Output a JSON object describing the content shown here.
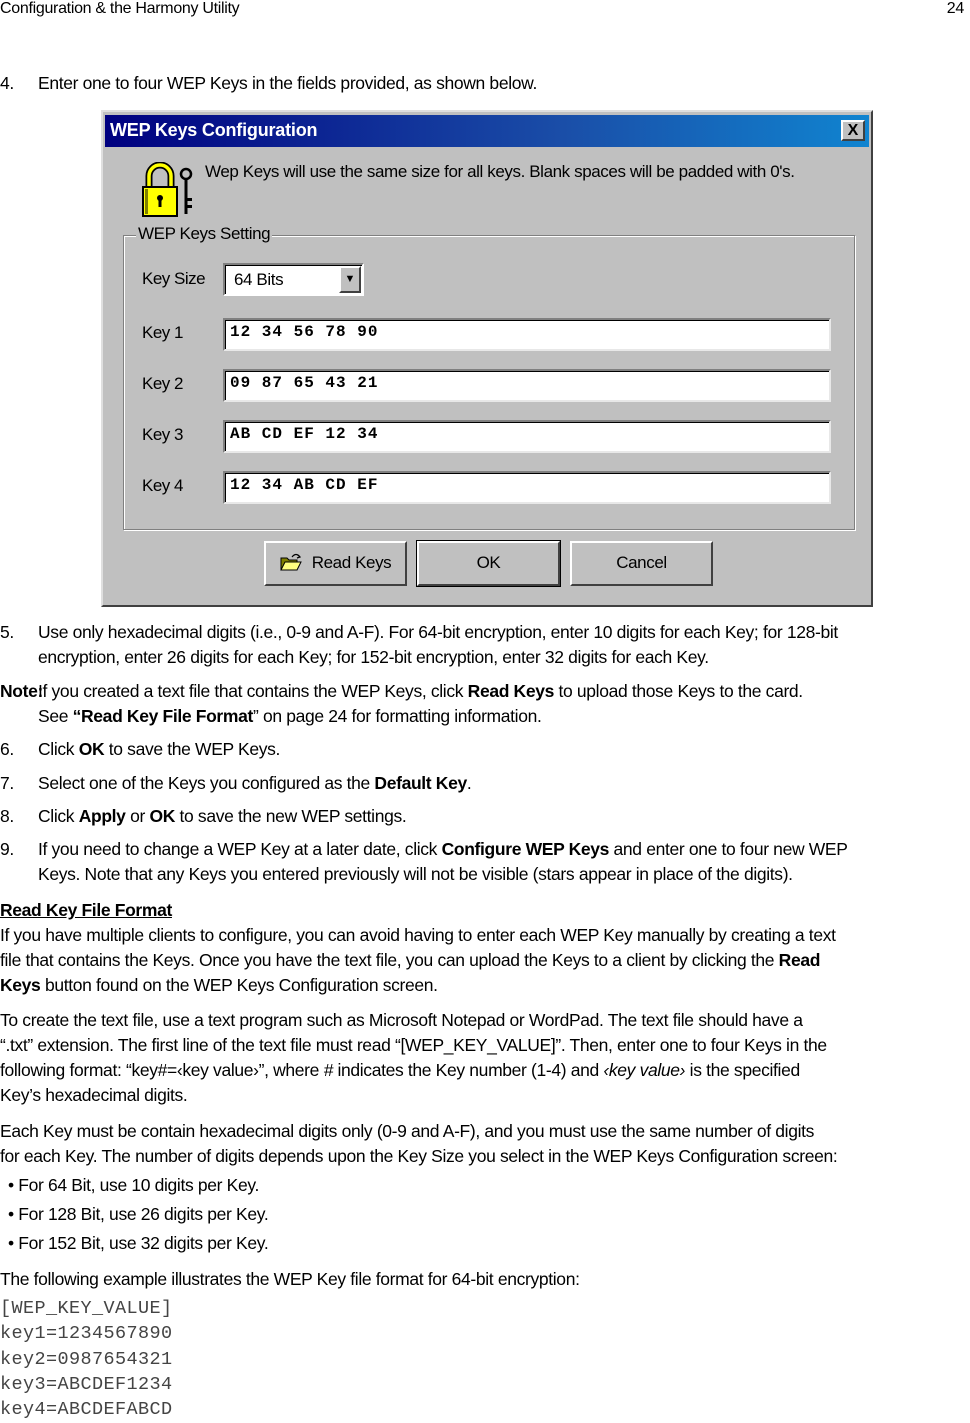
{
  "header": {
    "section_title": "Configuration & the Harmony Utility",
    "page_number": "24"
  },
  "step4": {
    "number": "4.",
    "text": "Enter one to four WEP Keys in the fields provided, as shown below."
  },
  "dialog": {
    "title": "WEP Keys Configuration",
    "close_label": "X",
    "info_text": "Wep Keys will use the same size for all keys. Blank spaces will be padded with 0's.",
    "group_label": "WEP Keys Setting",
    "key_size_label": "Key Size",
    "key_size_value": "64 Bits",
    "dropdown_arrow": "▼",
    "keys": [
      {
        "label": "Key 1",
        "value": "12 34 56 78 90"
      },
      {
        "label": "Key 2",
        "value": "09 87 65 43 21"
      },
      {
        "label": "Key 3",
        "value": "AB CD EF 12 34"
      },
      {
        "label": "Key 4",
        "value": "12 34 AB CD EF"
      }
    ],
    "buttons": {
      "read_keys": "Read Keys",
      "ok": "OK",
      "cancel": "Cancel"
    }
  },
  "step5": {
    "number": "5.",
    "line1": "Use only hexadecimal digits (i.e., 0-9 and A-F). For 64-bit encryption, enter 10 digits for each Key; for 128-bit",
    "line2": "encryption, enter 26 digits for each Key; for 152-bit encryption, enter 32 digits for each Key."
  },
  "note": {
    "label": "Note:",
    "l1_a": "If you created a text file that contains the WEP Keys, click ",
    "l1_b": "Read Keys",
    "l1_c": " to upload those Keys to the card.",
    "l2_a": "See ",
    "l2_b": "“Read Key File Format",
    "l2_c": "” on page 24 for formatting information."
  },
  "step6": {
    "number": "6.",
    "a": "Click ",
    "b": "OK",
    "c": " to save the WEP Keys."
  },
  "step7": {
    "number": "7.",
    "a": "Select one of the Keys you configured as the ",
    "b": "Default Key",
    "c": "."
  },
  "step8": {
    "number": "8.",
    "a": "Click ",
    "b": "Apply",
    "c": " or ",
    "d": "OK",
    "e": " to save the new WEP settings."
  },
  "step9": {
    "number": "9.",
    "a": "If you need to change a WEP Key at a later date, click ",
    "b": "Configure WEP Keys",
    "c": " and enter one to four new WEP",
    "line2": "Keys. Note that any Keys you entered previously will not be visible (stars appear in place of the digits)."
  },
  "read_key_section": {
    "heading": "Read Key File Format",
    "p1_l1": "If you have multiple clients to configure, you can avoid having to enter each WEP Key manually by creating a text",
    "p1_l2_a": "file that contains the Keys. Once you have the text file, you can upload the Keys to a client by clicking the ",
    "p1_l2_b": "Read",
    "p1_l3_a": "Keys",
    "p1_l3_b": " button found on the WEP Keys Configuration screen.",
    "p2_l1": "To create the text file, use a text program such as Microsoft Notepad or WordPad. The text file should have a",
    "p2_l2": "“.txt” extension. The first line of the text file must read “[WEP_KEY_VALUE]”. Then, enter one to four Keys in the",
    "p2_l3_a": "following format: “key#=‹key value›”, where ",
    "p2_l3_b": "#",
    "p2_l3_c": " indicates the Key number (1-4) and ",
    "p2_l3_d": "‹key value›",
    "p2_l3_e": " is the specified",
    "p2_l4": "Key’s hexadecimal digits.",
    "p3_l1": "Each Key must be contain hexadecimal digits only (0-9 and A-F), and you must use the same number of digits",
    "p3_l2": "for each Key. The number of digits depends upon the Key Size you select in the WEP Keys Configuration screen:",
    "bullets": [
      "• For 64 Bit, use 10 digits per Key.",
      "• For 128 Bit, use 26 digits per Key.",
      "• For 152 Bit, use 32 digits per Key."
    ],
    "example_intro": "The following example illustrates the WEP Key file format for 64-bit encryption:",
    "code_lines": [
      "[WEP_KEY_VALUE]",
      "key1=1234567890",
      "key2=0987654321",
      "key3=ABCDEF1234",
      "key4=ABCDEFABCD"
    ]
  }
}
